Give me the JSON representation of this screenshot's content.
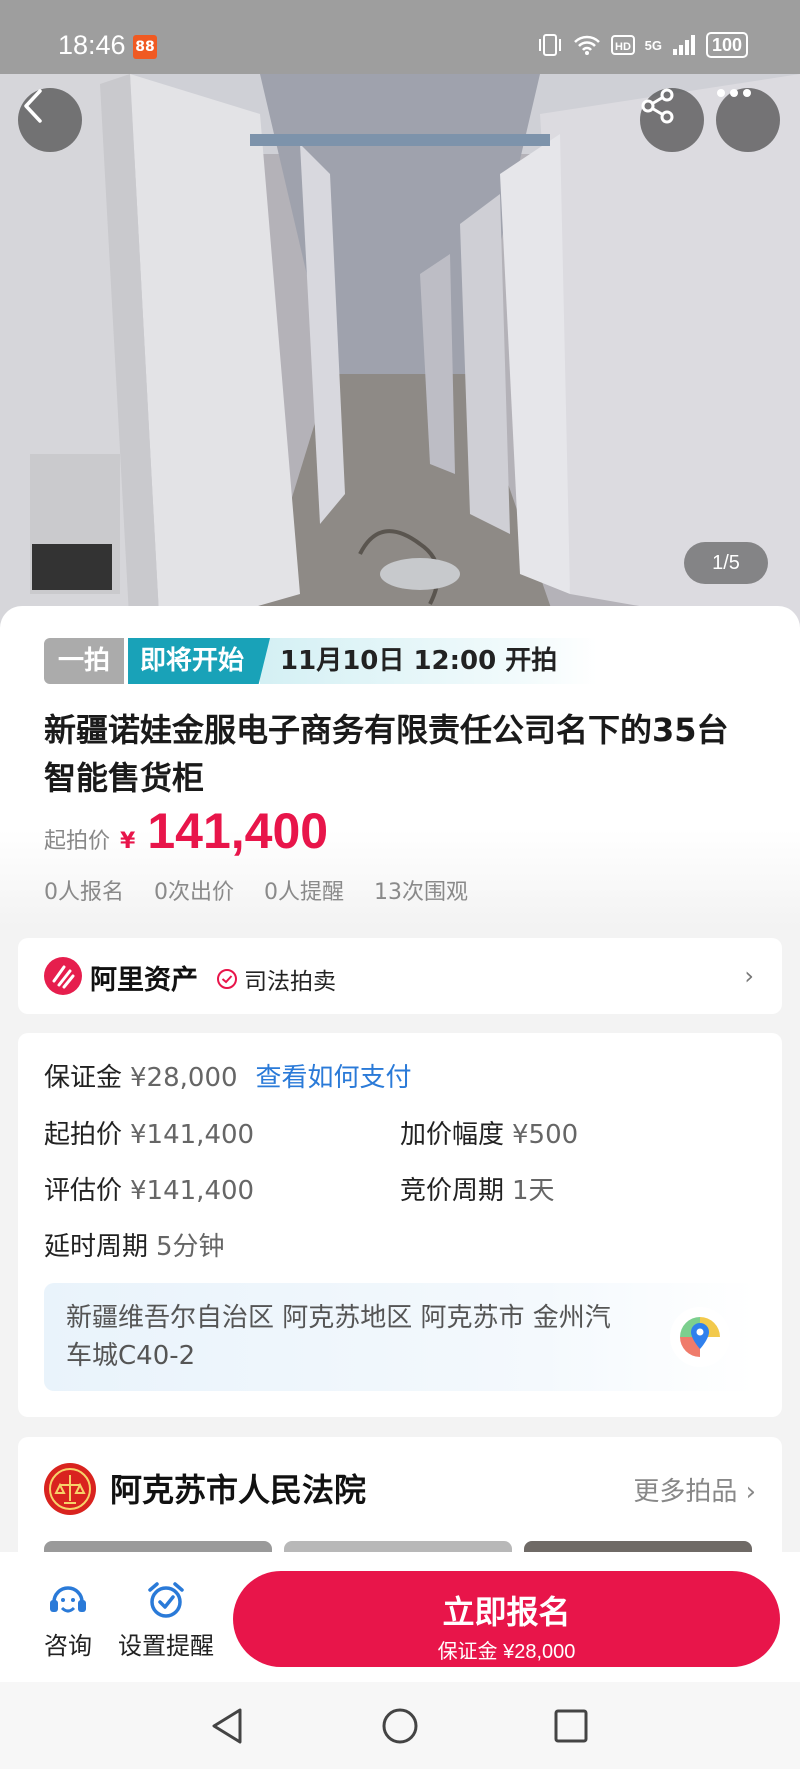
{
  "status_bar": {
    "time": "18:46",
    "app_badge": "88",
    "network": "5G",
    "battery": "100"
  },
  "hero": {
    "counter": "1/5",
    "icons": {
      "back": "back-arrow-icon",
      "share": "share-icon",
      "more": "more-dots-icon"
    }
  },
  "listing": {
    "tag_type": "一拍",
    "tag_status": "即将开始",
    "start_time": "11月10日 12:00 开拍",
    "title": "新疆诺娃金服电子商务有限责任公司名下的35台智能售货柜",
    "start_price_label": "起拍价",
    "currency": "¥",
    "start_price": "141,400",
    "stats": [
      "0人报名",
      "0次出价",
      "0人提醒",
      "13次围观"
    ]
  },
  "platform": {
    "name": "阿里资产",
    "badge": "司法拍卖"
  },
  "details": {
    "deposit_label": "保证金",
    "deposit_value": "¥28,000",
    "pay_link": "查看如何支付",
    "start_price_label": "起拍价",
    "start_price_value": "¥141,400",
    "increment_label": "加价幅度",
    "increment_value": "¥500",
    "appraisal_label": "评估价",
    "appraisal_value": "¥141,400",
    "cycle_label": "竞价周期",
    "cycle_value": "1天",
    "extension_label": "延时周期",
    "extension_value": "5分钟",
    "address": "新疆维吾尔自治区 阿克苏地区 阿克苏市 金州汽车城C40-2"
  },
  "court": {
    "name": "阿克苏市人民法院",
    "more": "更多拍品 ›"
  },
  "bottom_bar": {
    "consult": "咨询",
    "reminder": "设置提醒",
    "enroll_main": "立即报名",
    "enroll_sub": "保证金 ¥28,000"
  },
  "colors": {
    "accent_red": "#e8154a",
    "teal": "#19a2b8",
    "link_blue": "#2a7ad8"
  }
}
